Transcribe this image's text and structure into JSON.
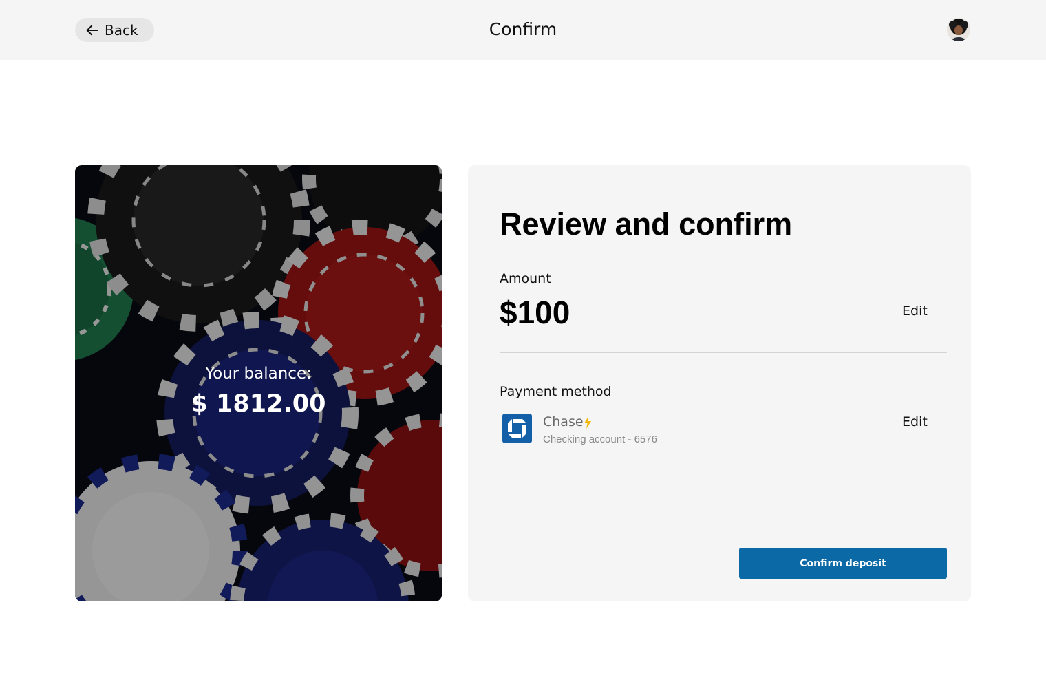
{
  "header": {
    "back_label": "Back",
    "title": "Confirm"
  },
  "balance": {
    "label": "Your balance:",
    "value": "$ 1812.00"
  },
  "review": {
    "title": "Review and confirm",
    "amount_label": "Amount",
    "amount_value": "$100",
    "amount_edit": "Edit",
    "payment_label": "Payment method",
    "bank_name": "Chase",
    "account_detail": "Checking account - 6576",
    "payment_edit": "Edit",
    "confirm_label": "Confirm deposit"
  },
  "icons": {
    "back": "arrow-left-icon",
    "avatar": "user-avatar",
    "bank": "chase-logo-icon",
    "instant": "lightning-bolt-icon"
  },
  "colors": {
    "accent": "#0b6aa6",
    "bank_brand": "#135fa8",
    "bolt": "#f2b705",
    "header_bg": "#f5f5f5",
    "card_bg": "#f5f5f5"
  }
}
